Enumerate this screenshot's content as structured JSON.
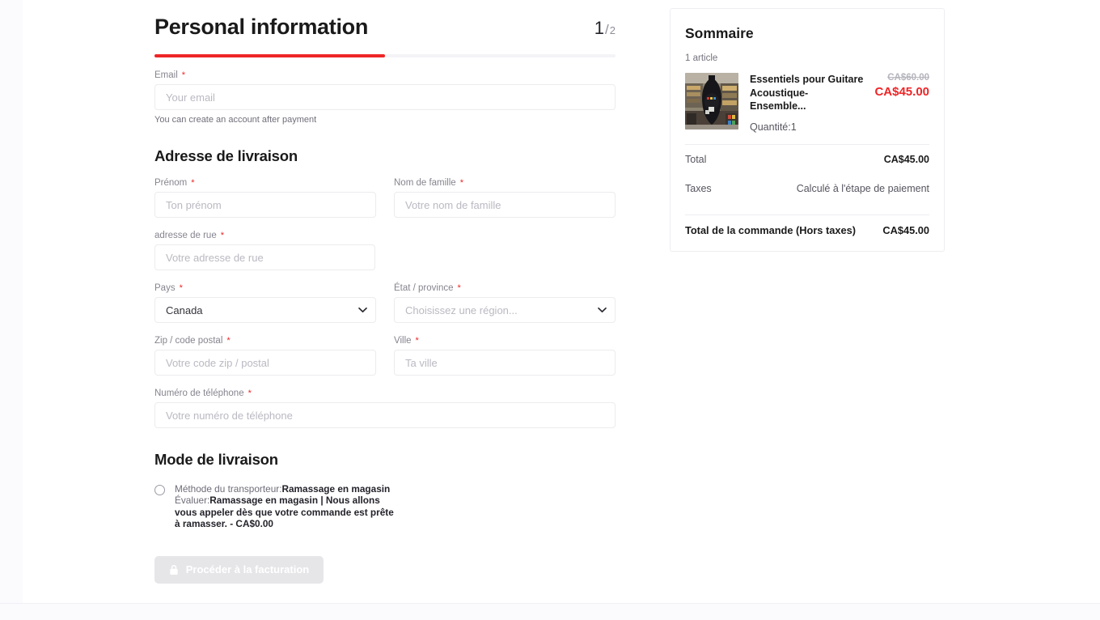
{
  "step_header": {
    "title": "Personal information",
    "current_step": "1",
    "separator": "/",
    "total_steps": "2",
    "progress_percent": 50,
    "accent_color": "#ee2527"
  },
  "email_section": {
    "label": "Email",
    "required_mark": "*",
    "placeholder": "Your email",
    "value": "",
    "hint": "You can create an account after payment"
  },
  "shipping_address": {
    "heading": "Adresse de livraison",
    "fields": {
      "first_name": {
        "label": "Prénom",
        "required_mark": "*",
        "placeholder": "Ton prénom",
        "value": ""
      },
      "last_name": {
        "label": "Nom de famille",
        "required_mark": "*",
        "placeholder": "Votre nom de famille",
        "value": ""
      },
      "street": {
        "label": "adresse de rue",
        "required_mark": "*",
        "placeholder": "Votre adresse de rue",
        "value": ""
      },
      "country": {
        "label": "Pays",
        "required_mark": "*",
        "selected": "Canada"
      },
      "state": {
        "label": "État / province",
        "required_mark": "*",
        "selected": "Choisissez une région..."
      },
      "zip": {
        "label": "Zip / code postal",
        "required_mark": "*",
        "placeholder": "Votre code zip / postal",
        "value": ""
      },
      "city": {
        "label": "Ville",
        "required_mark": "*",
        "placeholder": "Ta ville",
        "value": ""
      },
      "phone": {
        "label": "Numéro de téléphone",
        "required_mark": "*",
        "placeholder": "Votre numéro de téléphone",
        "value": ""
      }
    }
  },
  "shipping_method": {
    "heading": "Mode de livraison",
    "option": {
      "selected": false,
      "carrier_label": "Méthode du transporteur:",
      "carrier_value": "Ramassage en magasin",
      "rate_label": "Évaluer:",
      "rate_value": "Ramassage en magasin | Nous allons vous appeler dès que votre commande est prête à ramasser. - CA$0.00"
    }
  },
  "submit_button": {
    "label": "Procéder à la facturation",
    "icon": "lock-icon",
    "disabled": true
  },
  "summary": {
    "title": "Sommaire",
    "item_count_text": "1 article",
    "items": [
      {
        "name": "Essentiels pour Guitare Acoustique- Ensemble...",
        "original_price": "CA$60.00",
        "sale_price": "CA$45.00",
        "quantity_text": "Quantité:1",
        "thumbnail": "guitar-gig-bag-photo"
      }
    ],
    "totals": [
      {
        "label": "Total",
        "value": "CA$45.00",
        "emphasis": "bold"
      },
      {
        "label": "Taxes",
        "value": "Calculé à l'étape de paiement",
        "emphasis": "plain"
      }
    ],
    "grand_total": {
      "label": "Total de la commande (Hors taxes)",
      "value": "CA$45.00"
    }
  }
}
